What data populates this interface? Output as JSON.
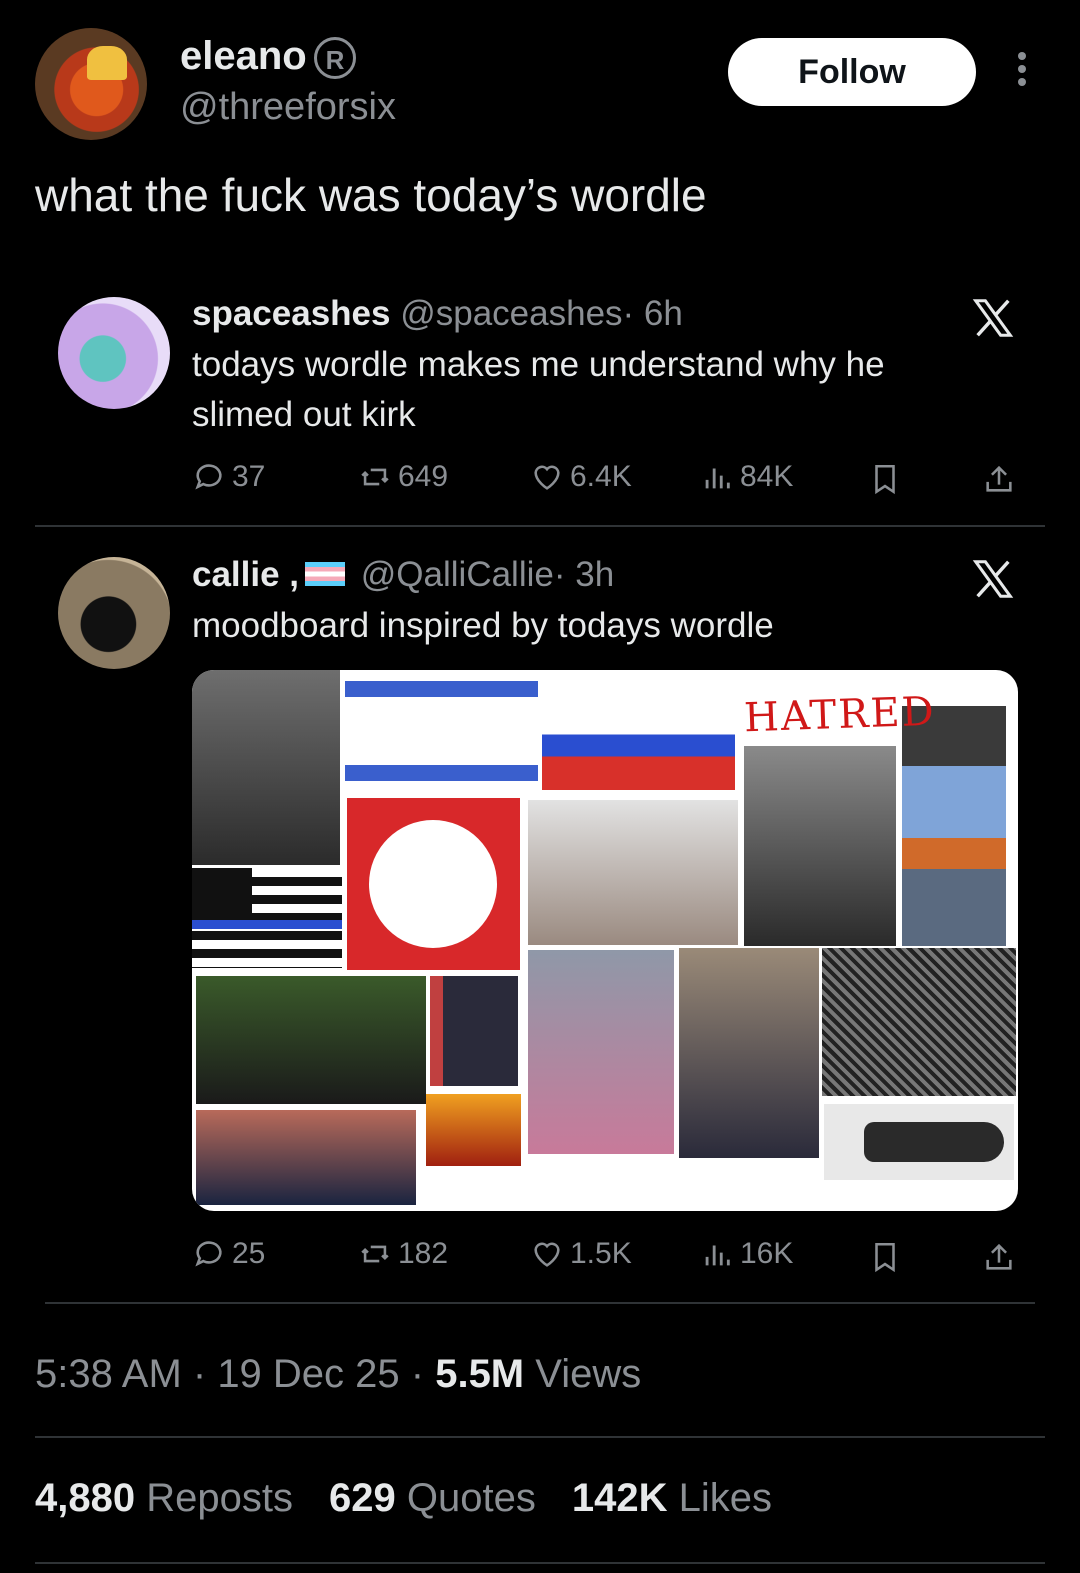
{
  "post": {
    "display_name": "eleano",
    "verified_mark": "R",
    "handle": "@threeforsix",
    "follow_label": "Follow",
    "text": "what the fuck was today’s wordle"
  },
  "quotes": [
    {
      "name": "spaceashes",
      "handle": "@spaceashes",
      "time": "· 6h",
      "text": "todays wordle makes me understand why he slimed out kirk",
      "stats": {
        "replies": "37",
        "reposts": "649",
        "likes": "6.4K",
        "views": "84K"
      }
    },
    {
      "name": "callie ,",
      "handle": "@QalliCallie",
      "time": "· 3h",
      "text": "moodboard inspired by todays wordle",
      "image_label": "HATRED",
      "stats": {
        "replies": "25",
        "reposts": "182",
        "likes": "1.5K",
        "views": "16K"
      }
    }
  ],
  "footer": {
    "time": "5:38 AM",
    "date": "19 Dec 25",
    "views_count": "5.5M",
    "views_label": "Views",
    "reposts_count": "4,880",
    "reposts_label": "Reposts",
    "quotes_count": "629",
    "quotes_label": "Quotes",
    "likes_count": "142K",
    "likes_label": "Likes"
  },
  "colors": {
    "background": "#000000",
    "text": "#e7e9ea",
    "muted": "#8b8f94",
    "divider": "#2f3336",
    "follow_bg": "#ffffff"
  },
  "icons": [
    "more-icon",
    "x-logo-icon",
    "reply-icon",
    "repost-icon",
    "like-icon",
    "views-icon",
    "bookmark-icon",
    "share-icon"
  ]
}
